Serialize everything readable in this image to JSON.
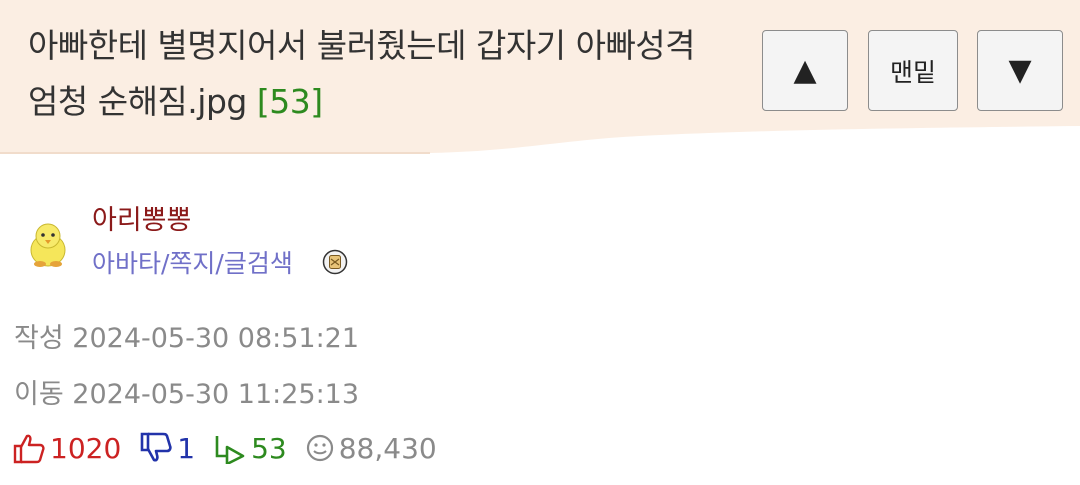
{
  "post": {
    "title": "아빠한테 별명지어서 불러줬는데 갑자기 아빠성격 엄청 순해짐.jpg",
    "comment_count": "[53]"
  },
  "nav": {
    "up_symbol": "▲",
    "bottom_label": "맨밑",
    "down_symbol": "▼"
  },
  "author": {
    "nickname": "아리뽕뽕",
    "links": "아바타/쪽지/글검색"
  },
  "meta": {
    "created_label": "작성",
    "created": "2024-05-30 08:51:21",
    "moved_label": "이동",
    "moved": "2024-05-30 11:25:13"
  },
  "stats": {
    "upvotes": "1020",
    "downvotes": "1",
    "comments": "53",
    "views": "88,430"
  },
  "colors": {
    "header_bg": "#fbeee3",
    "comment_green": "#2d8a1f",
    "nickname_red": "#8b1a1a",
    "link_purple": "#7070c8",
    "upvote_red": "#cc2222",
    "downvote_blue": "#2233aa"
  },
  "icons": [
    "thumbs-up-icon",
    "thumbs-down-icon",
    "reply-icon",
    "eye-icon",
    "avatar-chick-icon",
    "level-badge-icon"
  ]
}
